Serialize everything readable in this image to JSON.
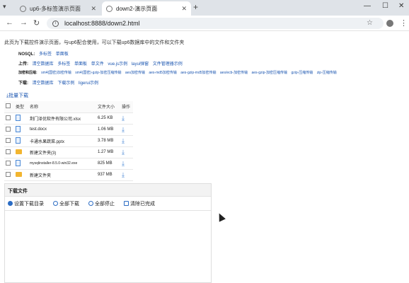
{
  "browser": {
    "tabs": [
      {
        "label": "up6-多标签演示页面",
        "active": false
      },
      {
        "label": "down2-演示页面",
        "active": true
      }
    ],
    "url": "localhost:8888/down2.html"
  },
  "page": {
    "intro": "此页为下载控件演示页面，与up6配合使用，可以下载up6数据库中的文件和文件夹",
    "rows": [
      {
        "label": "NOSQL:",
        "links": [
          "多标签",
          "单面板"
        ]
      },
      {
        "label": "上传:",
        "links": [
          "清空数据库",
          "多标签",
          "单面板",
          "单文件",
          "vue.js示例",
          "layui弹窗",
          "文件管理器示例"
        ]
      },
      {
        "label": "加密和压缩:",
        "links": [
          "sm4(国密)加密传输",
          "sm4(国密)-gzip-加密压缩传输",
          "aes加密传输",
          "aes-md5加密传输",
          "aes-gzip-md5加密传输",
          "aes/ecb-加密传输",
          "aes-gzip-加密压缩传输",
          "gzip-压缩传输",
          "zip-压缩传输"
        ]
      },
      {
        "label": "下载:",
        "links": [
          "清空数据库",
          "下载示例",
          "ligerui示例"
        ]
      }
    ],
    "batch_download": "批量下载",
    "table": {
      "headers": [
        "",
        "类型",
        "名称",
        "文件大小",
        "操作"
      ],
      "rows": [
        {
          "type": "file",
          "name": "荆门泽优软件有限公司.xlsx",
          "size": "6.25 KB"
        },
        {
          "type": "file",
          "name": "test.docx",
          "size": "1.06 MB"
        },
        {
          "type": "file",
          "name": "卡通水果蔬菜.pptx",
          "size": "3.78 MB"
        },
        {
          "type": "folder",
          "name": "新建文件夹(3)",
          "size": "1.27 MB"
        },
        {
          "type": "file",
          "name": "mysqlinstaller-8.5.0-win32.exe",
          "size": "825 MB"
        },
        {
          "type": "folder",
          "name": "新建文件夹",
          "size": "937 MB"
        }
      ]
    },
    "download_panel": {
      "title": "下载文件",
      "tools": [
        "设置下载目录",
        "全部下载",
        "全部停止",
        "清除已完成"
      ]
    }
  },
  "colors": {
    "link": "#1a55b0",
    "accent": "#4a88d6",
    "folder": "#f2b530"
  }
}
